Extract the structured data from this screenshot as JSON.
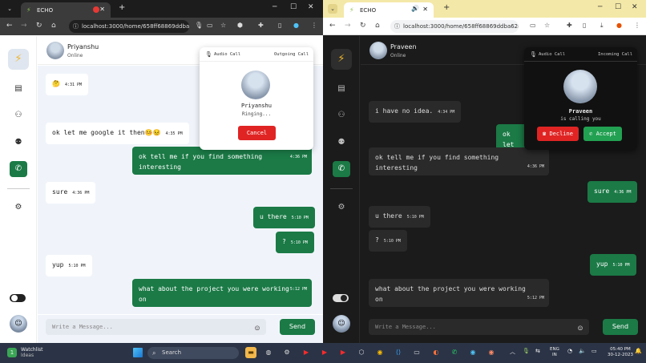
{
  "left": {
    "tab_title": "ECHO",
    "url": "localhost:3000/home/658ff68869ddba6...",
    "contact": {
      "name": "Priyanshu",
      "status": "Online"
    },
    "messages": [
      {
        "dir": "in",
        "text": "🤔",
        "time": "4:31 PM"
      },
      {
        "dir": "in",
        "text": "ok let me google it then🤒😣",
        "time": "4:35 PM"
      },
      {
        "dir": "out",
        "text": "ok tell me if you find something interesting",
        "time": "4:36 PM"
      },
      {
        "dir": "in",
        "text": "sure",
        "time": "4:36 PM"
      },
      {
        "dir": "out",
        "text": "u there",
        "time": "5:10 PM"
      },
      {
        "dir": "out",
        "text": "?",
        "time": "5:10 PM"
      },
      {
        "dir": "in",
        "text": "yup",
        "time": "5:10 PM"
      },
      {
        "dir": "out",
        "text": "what about the project you were working on",
        "time": "5:12 PM"
      }
    ],
    "composer": {
      "placeholder": "Write a Message...",
      "send_label": "Send"
    },
    "call": {
      "type": "Audio Call",
      "direction": "Outgoing Call",
      "name": "Priyanshu",
      "status": "Ringing...",
      "cancel_label": "Cancel"
    }
  },
  "right": {
    "tab_title": "ECHO",
    "url": "localhost:3000/home/658ff68869ddba628a6d...",
    "contact": {
      "name": "Praveen",
      "status": "Online"
    },
    "messages": [
      {
        "dir": "in",
        "text": "i have no idea.",
        "time": "4:34 PM"
      },
      {
        "dir": "out",
        "text": "ok let",
        "time": ""
      },
      {
        "dir": "in",
        "text": "ok tell me if you find something interesting",
        "time": "4:36 PM"
      },
      {
        "dir": "out",
        "text": "sure",
        "time": "4:36 PM"
      },
      {
        "dir": "in",
        "text": "u there",
        "time": "5:10 PM"
      },
      {
        "dir": "in",
        "text": "?",
        "time": "5:10 PM"
      },
      {
        "dir": "out",
        "text": "yup",
        "time": "5:10 PM"
      },
      {
        "dir": "in",
        "text": "what about the project you were working on",
        "time": "5:12 PM"
      }
    ],
    "composer": {
      "placeholder": "Write a Message...",
      "send_label": "Send"
    },
    "call": {
      "type": "Audio Call",
      "direction": "Incoming Call",
      "name": "Praveen",
      "status": "is calling you",
      "decline_label": "Decline",
      "accept_label": "Accept"
    }
  },
  "taskbar": {
    "widget_title": "Watchlist",
    "widget_sub": "Ideas",
    "widget_badge": "1",
    "search_placeholder": "Search",
    "lang_line1": "ENG",
    "lang_line2": "IN",
    "time": "05:40 PM",
    "date": "30-12-2023"
  },
  "colors": {
    "accent_green": "#1b7a46",
    "danger_red": "#e02424",
    "accept_green": "#22a152",
    "logo_yellow": "#f0b429"
  }
}
